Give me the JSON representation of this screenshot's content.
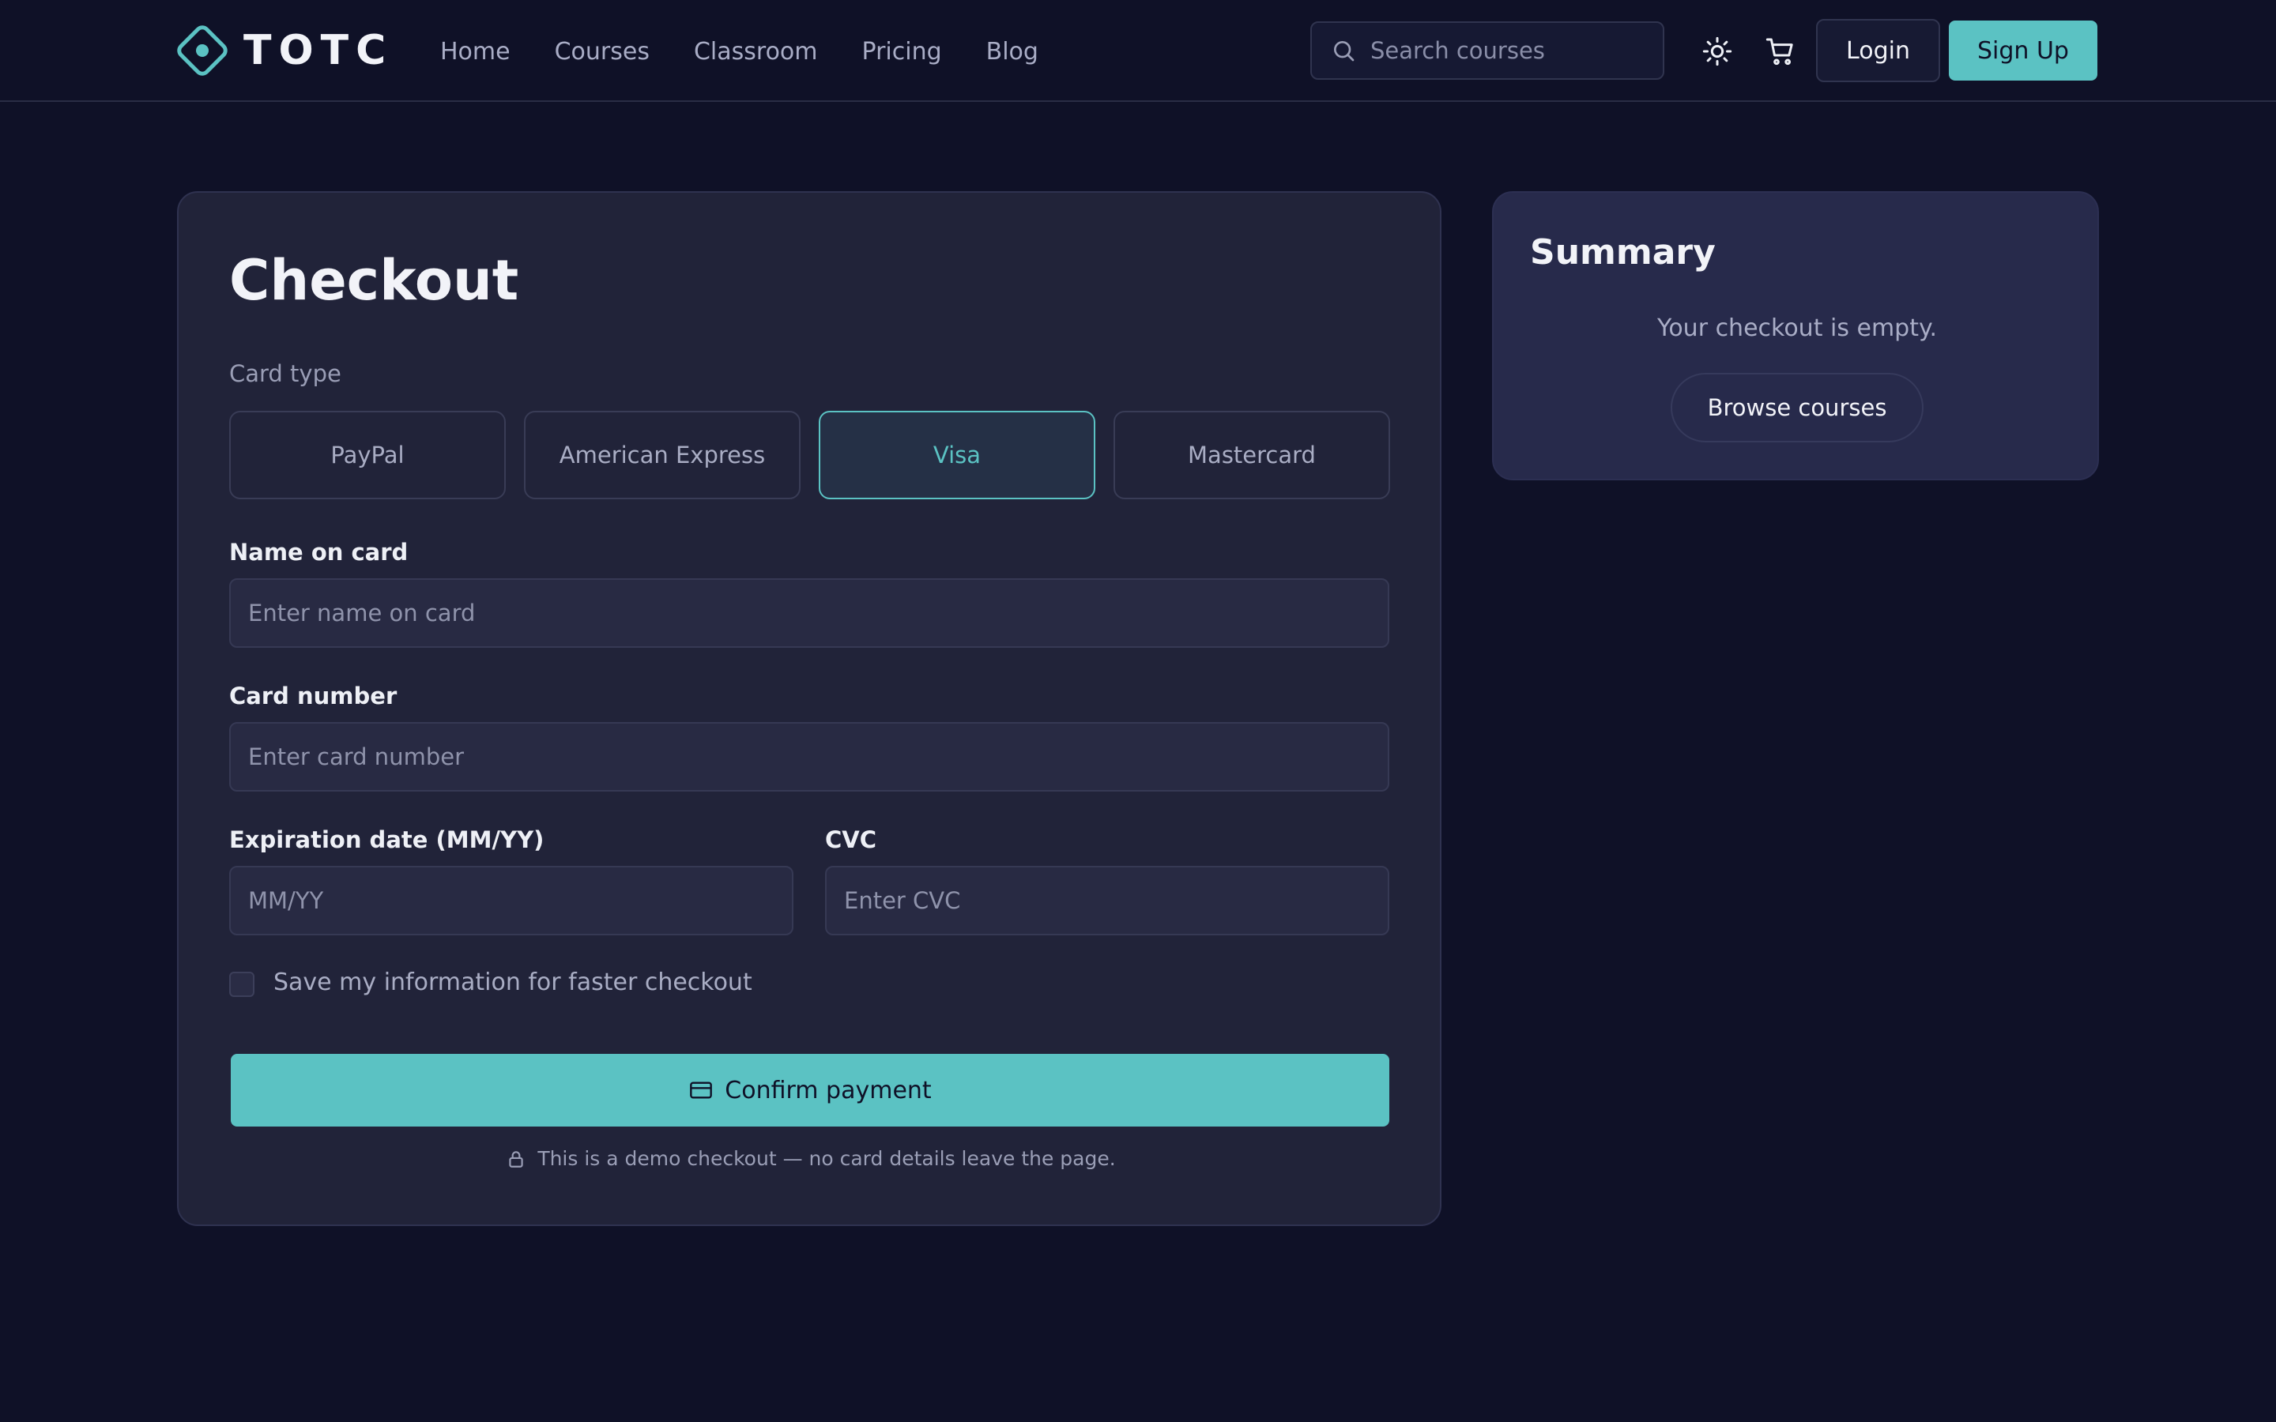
{
  "brand": {
    "name": "TOTC",
    "accent": "#5bc2c3",
    "background": "#0f1127"
  },
  "nav": {
    "items": [
      {
        "label": "Home"
      },
      {
        "label": "Courses"
      },
      {
        "label": "Classroom"
      },
      {
        "label": "Pricing"
      },
      {
        "label": "Blog"
      }
    ]
  },
  "search": {
    "placeholder": "Search courses",
    "icon": "search-icon"
  },
  "header_icons": {
    "theme": "sun-icon",
    "cart": "cart-icon"
  },
  "auth": {
    "login_label": "Login",
    "signup_label": "Sign Up"
  },
  "checkout": {
    "title": "Checkout",
    "card_type_label": "Card type",
    "card_types": [
      {
        "label": "PayPal",
        "selected": false
      },
      {
        "label": "American Express",
        "selected": false
      },
      {
        "label": "Visa",
        "selected": true
      },
      {
        "label": "Mastercard",
        "selected": false
      }
    ],
    "name_label": "Name on card",
    "name_placeholder": "Enter name on card",
    "number_label": "Card number",
    "number_placeholder": "Enter card number",
    "expiry_label": "Expiration date (MM/YY)",
    "expiry_placeholder": "MM/YY",
    "cvc_label": "CVC",
    "cvc_placeholder": "Enter CVC",
    "save_info_label": "Save my information for faster checkout",
    "save_info_checked": false,
    "confirm_label": "Confirm payment",
    "demo_note": "This is a demo checkout — no card details leave the page."
  },
  "summary": {
    "title": "Summary",
    "empty_text": "Your checkout is empty.",
    "browse_label": "Browse courses"
  }
}
